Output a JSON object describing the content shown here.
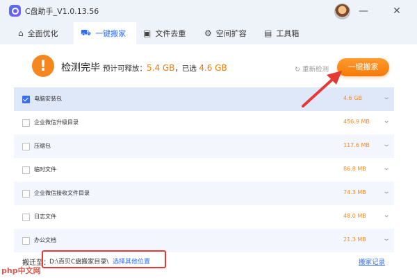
{
  "app": {
    "title": "C盘助手_V1.0.13.56"
  },
  "window": {
    "min_label": "—",
    "close_label": "✕"
  },
  "tabs": [
    {
      "label": "全面优化",
      "icon": "home-icon"
    },
    {
      "label": "一键搬家",
      "icon": "truck-icon"
    },
    {
      "label": "文件去重",
      "icon": "files-icon"
    },
    {
      "label": "空间扩容",
      "icon": "rocket-icon"
    },
    {
      "label": "工具箱",
      "icon": "toolbox-icon"
    }
  ],
  "status": {
    "title": "检测完毕",
    "prefix": "预计可释放：",
    "release_size": "5.4 GB",
    "middle": "，已选",
    "selected_size": "4.6 GB",
    "rescan_label": "重新检测",
    "move_button_label": "一键搬家"
  },
  "items": [
    {
      "label": "电脑安装包",
      "size": "4.6 GB",
      "checked": true
    },
    {
      "label": "企业微信升级目录",
      "size": "456.9 MB",
      "checked": false
    },
    {
      "label": "压缩包",
      "size": "117.6 MB",
      "checked": false
    },
    {
      "label": "临时文件",
      "size": "86.8 MB",
      "checked": false
    },
    {
      "label": "企业微信接收文件目录",
      "size": "74.3 MB",
      "checked": false
    },
    {
      "label": "日志文件",
      "size": "48.0 MB",
      "checked": false
    },
    {
      "label": "办公文档",
      "size": "21.3 MB",
      "checked": false
    }
  ],
  "footer": {
    "label": "搬迁至：",
    "path": "D:\\百贝C盘搬家目录\\",
    "choose_link": "选择其他位置",
    "history_link": "搬家记录"
  },
  "watermark": {
    "text": "php中文网"
  },
  "colors": {
    "accent": "#2f6bff",
    "orange": "#f57a0a",
    "highlight_red": "#e53935"
  }
}
